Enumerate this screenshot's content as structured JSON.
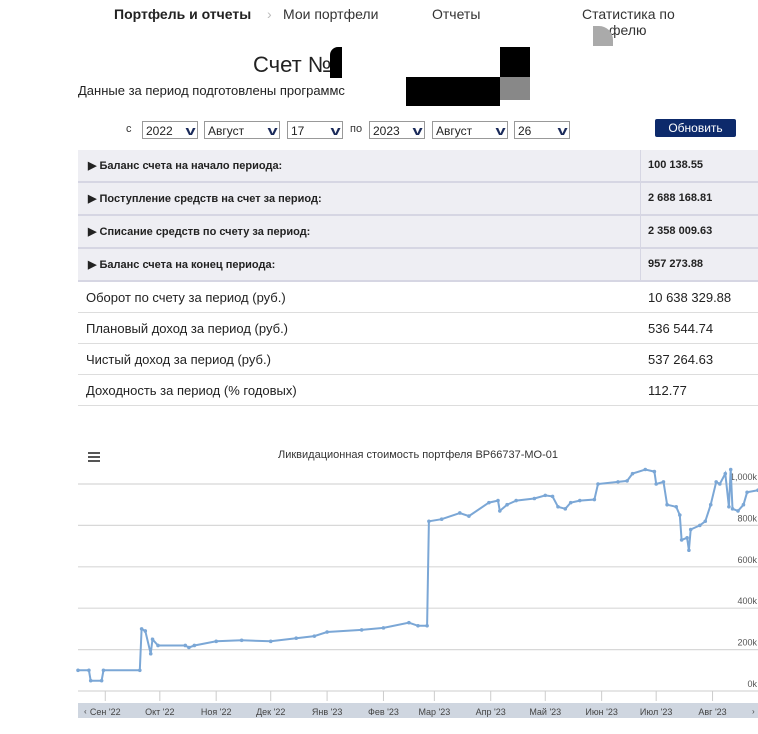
{
  "nav": {
    "section": "Портфель и отчеты",
    "separator": "›",
    "items": [
      "Мои портфели",
      "Отчеты",
      "Статистика по",
      "фелю"
    ]
  },
  "header": {
    "account_title": "Счет №",
    "period_note": "Данные за период подготовлены программс"
  },
  "filter": {
    "from_label": "с",
    "to_label": "по",
    "from_year": "2022",
    "from_month": "Август",
    "from_day": "17",
    "to_year": "2023",
    "to_month": "Август",
    "to_day": "26",
    "refresh_label": "Обновить",
    "accent": "#0d2a6b"
  },
  "summary": [
    {
      "label": "Баланс счета на начало периода:",
      "value": "100 138.55"
    },
    {
      "label": "Поступление средств на счет за период:",
      "value": "2 688 168.81"
    },
    {
      "label": "Списание средств по счету за период:",
      "value": "2 358 009.63"
    },
    {
      "label": "Баланс счета на конец периода:",
      "value": "957 273.88"
    }
  ],
  "stats": [
    {
      "label": "Оборот по счету за период (руб.)",
      "value": "10 638 329.88"
    },
    {
      "label": "Плановый доход за период (руб.)",
      "value": "536 544.74"
    },
    {
      "label": "Чистый доход за период (руб.)",
      "value": "537 264.63"
    },
    {
      "label": "Доходность за период (% годовых)",
      "value": "112.77"
    }
  ],
  "chart_data": {
    "type": "line",
    "title": "Ликвидационная стоимость портфеля BP66737-MO-01",
    "color": "#7ba7d6",
    "grid": true,
    "ylim": [
      0,
      1000000
    ],
    "yticks": [
      0,
      200000,
      400000,
      600000,
      800000,
      1000000
    ],
    "ytick_labels": [
      "0k",
      "200k",
      "400k",
      "600k",
      "800k",
      "1,000k"
    ],
    "xlim": [
      "2022-08-17",
      "2023-08-26"
    ],
    "xticks": [
      "2022-09-01",
      "2022-10-01",
      "2022-11-01",
      "2022-12-01",
      "2023-01-01",
      "2023-02-01",
      "2023-03-01",
      "2023-04-01",
      "2023-05-01",
      "2023-06-01",
      "2023-07-01",
      "2023-08-01"
    ],
    "xtick_labels": [
      "Сен '22",
      "Окт '22",
      "Ноя '22",
      "Дек '22",
      "Янв '23",
      "Фев '23",
      "Мар '23",
      "Апр '23",
      "Май '23",
      "Июн '23",
      "Июл '23",
      "Авг '23"
    ],
    "points": [
      [
        "2022-08-17",
        100000
      ],
      [
        "2022-08-23",
        100000
      ],
      [
        "2022-08-24",
        50000
      ],
      [
        "2022-08-30",
        50000
      ],
      [
        "2022-08-31",
        100000
      ],
      [
        "2022-09-20",
        100000
      ],
      [
        "2022-09-21",
        300000
      ],
      [
        "2022-09-23",
        290000
      ],
      [
        "2022-09-26",
        180000
      ],
      [
        "2022-09-27",
        250000
      ],
      [
        "2022-09-30",
        220000
      ],
      [
        "2022-10-15",
        220000
      ],
      [
        "2022-10-17",
        210000
      ],
      [
        "2022-10-20",
        220000
      ],
      [
        "2022-11-01",
        240000
      ],
      [
        "2022-11-15",
        245000
      ],
      [
        "2022-12-01",
        240000
      ],
      [
        "2022-12-15",
        255000
      ],
      [
        "2022-12-25",
        265000
      ],
      [
        "2023-01-01",
        285000
      ],
      [
        "2023-01-20",
        295000
      ],
      [
        "2023-02-01",
        305000
      ],
      [
        "2023-02-15",
        330000
      ],
      [
        "2023-02-20",
        315000
      ],
      [
        "2023-02-25",
        315000
      ],
      [
        "2023-02-26",
        820000
      ],
      [
        "2023-03-05",
        830000
      ],
      [
        "2023-03-15",
        860000
      ],
      [
        "2023-03-20",
        845000
      ],
      [
        "2023-03-31",
        910000
      ],
      [
        "2023-04-05",
        920000
      ],
      [
        "2023-04-06",
        870000
      ],
      [
        "2023-04-10",
        900000
      ],
      [
        "2023-04-15",
        920000
      ],
      [
        "2023-04-25",
        930000
      ],
      [
        "2023-05-01",
        945000
      ],
      [
        "2023-05-05",
        940000
      ],
      [
        "2023-05-08",
        890000
      ],
      [
        "2023-05-12",
        880000
      ],
      [
        "2023-05-15",
        910000
      ],
      [
        "2023-05-20",
        920000
      ],
      [
        "2023-05-28",
        925000
      ],
      [
        "2023-05-30",
        1000000
      ],
      [
        "2023-06-10",
        1010000
      ],
      [
        "2023-06-15",
        1015000
      ],
      [
        "2023-06-18",
        1050000
      ],
      [
        "2023-06-25",
        1070000
      ],
      [
        "2023-06-30",
        1060000
      ],
      [
        "2023-07-01",
        1000000
      ],
      [
        "2023-07-05",
        1010000
      ],
      [
        "2023-07-07",
        900000
      ],
      [
        "2023-07-12",
        890000
      ],
      [
        "2023-07-14",
        850000
      ],
      [
        "2023-07-15",
        730000
      ],
      [
        "2023-07-18",
        740000
      ],
      [
        "2023-07-19",
        680000
      ],
      [
        "2023-07-20",
        780000
      ],
      [
        "2023-07-25",
        800000
      ],
      [
        "2023-07-28",
        820000
      ],
      [
        "2023-07-31",
        900000
      ],
      [
        "2023-08-03",
        1010000
      ],
      [
        "2023-08-05",
        1000000
      ],
      [
        "2023-08-08",
        1050000
      ],
      [
        "2023-08-10",
        890000
      ],
      [
        "2023-08-11",
        1070000
      ],
      [
        "2023-08-12",
        880000
      ],
      [
        "2023-08-15",
        870000
      ],
      [
        "2023-08-18",
        900000
      ],
      [
        "2023-08-20",
        960000
      ],
      [
        "2023-08-26",
        970000
      ]
    ]
  }
}
